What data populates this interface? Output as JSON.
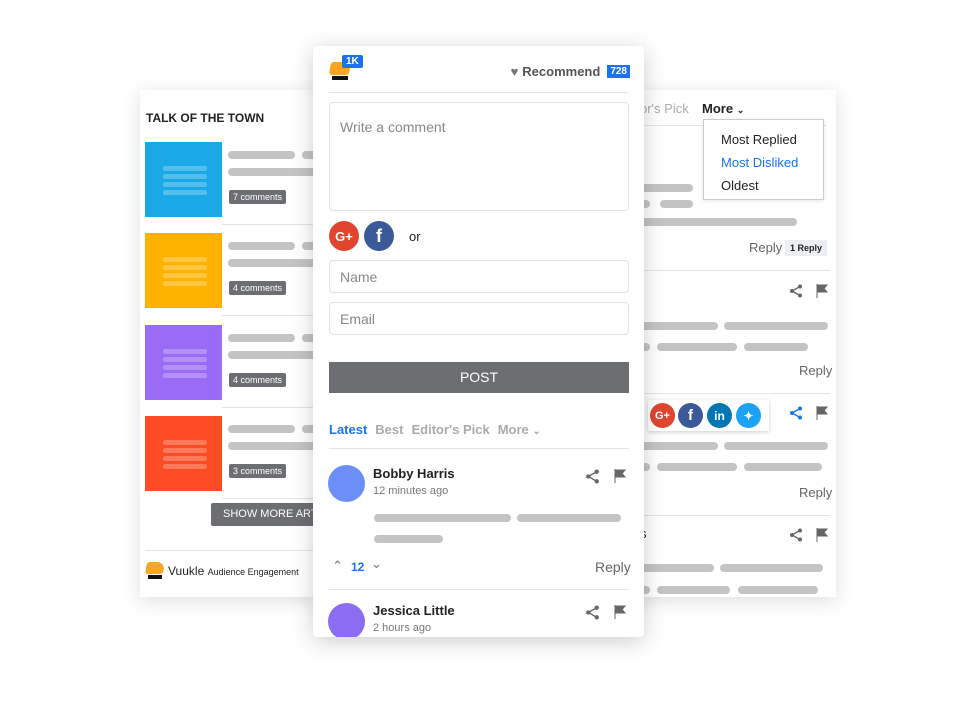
{
  "left": {
    "title": "TALK OF THE TOWN",
    "articles": [
      {
        "color": "#1ba8e6",
        "comments": "7 comments"
      },
      {
        "color": "#ffb300",
        "comments": "4 comments"
      },
      {
        "color": "#9a6cf5",
        "comments": "4 comments"
      },
      {
        "color": "#ff4c24",
        "comments": "3 comments"
      }
    ],
    "show_more": "SHOW MORE ARTICLES",
    "brand": "Vuukle",
    "brand_tagline": "Audience Engagement"
  },
  "center": {
    "count_badge": "1K",
    "recommend": "Recommend",
    "recommend_count": "728",
    "comment_placeholder": "Write a comment",
    "or": "or",
    "name_placeholder": "Name",
    "email_placeholder": "Email",
    "post": "POST",
    "tabs": [
      {
        "label": "Latest",
        "active": true
      },
      {
        "label": "Best"
      },
      {
        "label": "Editor's Pick"
      },
      {
        "label": "More"
      }
    ],
    "comments": [
      {
        "name": "Bobby Harris",
        "time": "12 minutes ago",
        "avatar_color": "#6b8ff7",
        "votes": "12",
        "reply": "Reply"
      },
      {
        "name": "Jessica Little",
        "time": "2 hours ago",
        "avatar_color": "#8c6cf0"
      }
    ]
  },
  "right": {
    "tab_partial": "or's Pick",
    "more": "More",
    "menu": [
      {
        "label": "Most Replied"
      },
      {
        "label": "Most Disliked",
        "active": true
      },
      {
        "label": "Oldest"
      }
    ],
    "reply": "Reply",
    "replies_badge": "1 Reply",
    "partial_char": "s"
  },
  "colors": {
    "accent": "#1a73e8",
    "button": "#6d6e71",
    "google": "#e0452f",
    "facebook": "#3b5998",
    "linkedin": "#0077b5",
    "twitter": "#1da1f2"
  }
}
